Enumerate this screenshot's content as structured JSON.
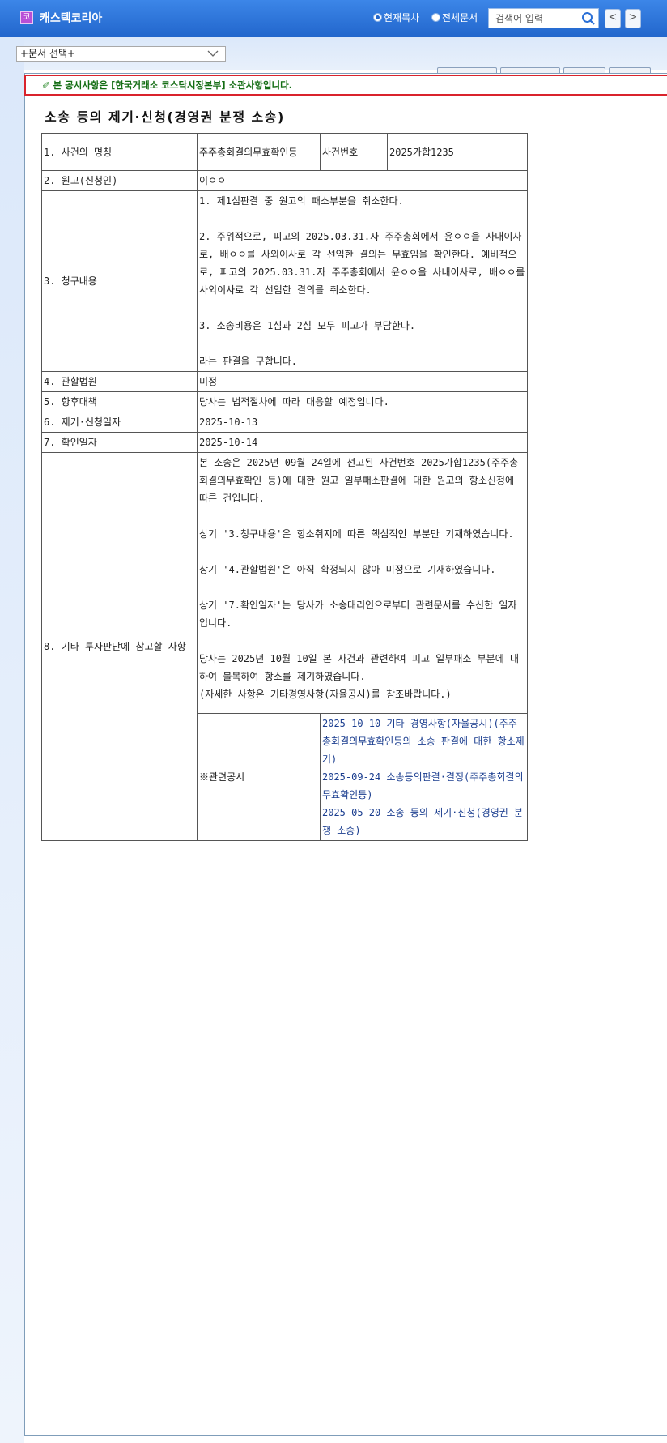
{
  "header": {
    "logo_char": "코",
    "company_name": "캐스텍코리아",
    "scope_current": "현재목차",
    "scope_all": "전체문서",
    "search_placeholder": "검색어 입력",
    "prev": "<",
    "next": ">"
  },
  "doc_select": {
    "value": "+문서 선택+"
  },
  "notice": {
    "icon": "✐",
    "text": "본 공시사항은 [한국거래소 코스닥시장본부] 소관사항입니다."
  },
  "title": "소송 등의 제기·신청(경영권 분쟁 소송)",
  "table": {
    "r1_label": "1. 사건의 명칭",
    "r1_value": "주주총회결의무효확인등",
    "r1_caseno_label": "사건번호",
    "r1_caseno_value": "2025가합1235",
    "r2_label": "2. 원고(신청인)",
    "r2_value": "이ㅇㅇ",
    "r3_label": "3. 청구내용",
    "r3_lines": [
      "1. 제1심판결 중 원고의 패소부분을 취소한다.",
      "2. 주위적으로, 피고의 2025.03.31.자 주주총회에서 윤ㅇㅇ을 사내이사로, 배ㅇㅇ를 사외이사로 각 선임한 결의는 무효임을 확인한다. 예비적으로, 피고의 2025.03.31.자 주주총회에서 윤ㅇㅇ을 사내이사로, 배ㅇㅇ를 사외이사로 각 선임한 결의를 취소한다.",
      "3. 소송비용은 1심과 2심 모두 피고가 부담한다.",
      "라는 판결을 구합니다."
    ],
    "r4_label": "4. 관할법원",
    "r4_value": "미정",
    "r5_label": "5. 향후대책",
    "r5_value": "당사는 법적절차에 따라 대응할 예정입니다.",
    "r6_label": "6. 제기·신청일자",
    "r6_value": "2025-10-13",
    "r7_label": "7. 확인일자",
    "r7_value": "2025-10-14",
    "r8_label": "8. 기타 투자판단에 참고할 사항",
    "r8_lines": [
      "본 소송은 2025년 09월 24일에 선고된 사건번호 2025가합1235(주주총회결의무효확인 등)에 대한 원고 일부패소판결에 대한 원고의 항소신청에 따른 건입니다.",
      "상기 '3.청구내용'은 항소취지에 따른 핵심적인 부분만 기재하였습니다.",
      "상기 '4.관할법원'은 아직 확정되지 않아 미정으로 기재하였습니다.",
      "상기 '7.확인일자'는 당사가 소송대리인으로부터 관련문서를 수신한 일자입니다.",
      "당사는 2025년 10월 10일 본 사건과 관련하여 피고 일부패소 부분에 대하여 불복하여 항소를 제기하였습니다.\n(자세한 사항은 기타경영사항(자율공시)를 참조바랍니다.)"
    ],
    "related_label": "※관련공시",
    "related": [
      "2025-10-10 기타 경영사항(자율공시)(주주총회결의무효확인등의 소송 판결에 대한 항소제기)",
      "2025-09-24 소송등의판결·결정(주주총회결의무효확인등)",
      "2025-05-20 소송 등의 제기·신청(경영권 분쟁 소송)"
    ]
  }
}
